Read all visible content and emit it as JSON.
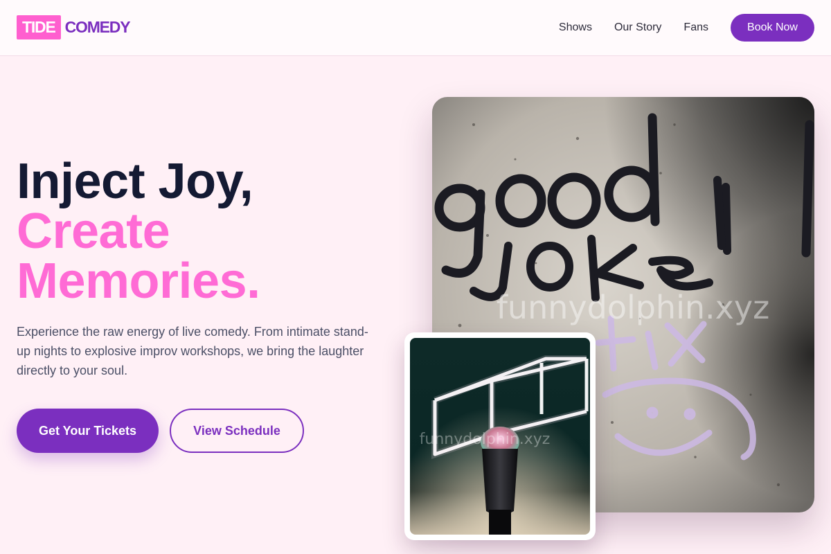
{
  "brand": {
    "logo_box": "TIDE",
    "logo_text": "COMEDY"
  },
  "nav": {
    "items": [
      {
        "label": "Shows"
      },
      {
        "label": "Our Story"
      },
      {
        "label": "Fans"
      }
    ],
    "cta": "Book Now"
  },
  "hero": {
    "line1": "Inject Joy,",
    "line2": "Create",
    "line3": "Memories.",
    "subtitle": "Experience the raw energy of live comedy. From intimate stand-up nights to explosive improv workshops, we bring the laughter directly to your soul.",
    "primary_button": "Get Your Tickets",
    "secondary_button": "View Schedule"
  },
  "images": {
    "main": {
      "graffiti_text_1": "good",
      "graffiti_text_2": "joke",
      "watermark": "funnydolphin.xyz"
    },
    "small": {
      "watermark": "funnydolphin.xyz"
    }
  },
  "colors": {
    "brand_purple": "#7b2fbf",
    "brand_pink": "#ff6bd5",
    "background": "#fff0f6",
    "heading_dark": "#141a33"
  }
}
